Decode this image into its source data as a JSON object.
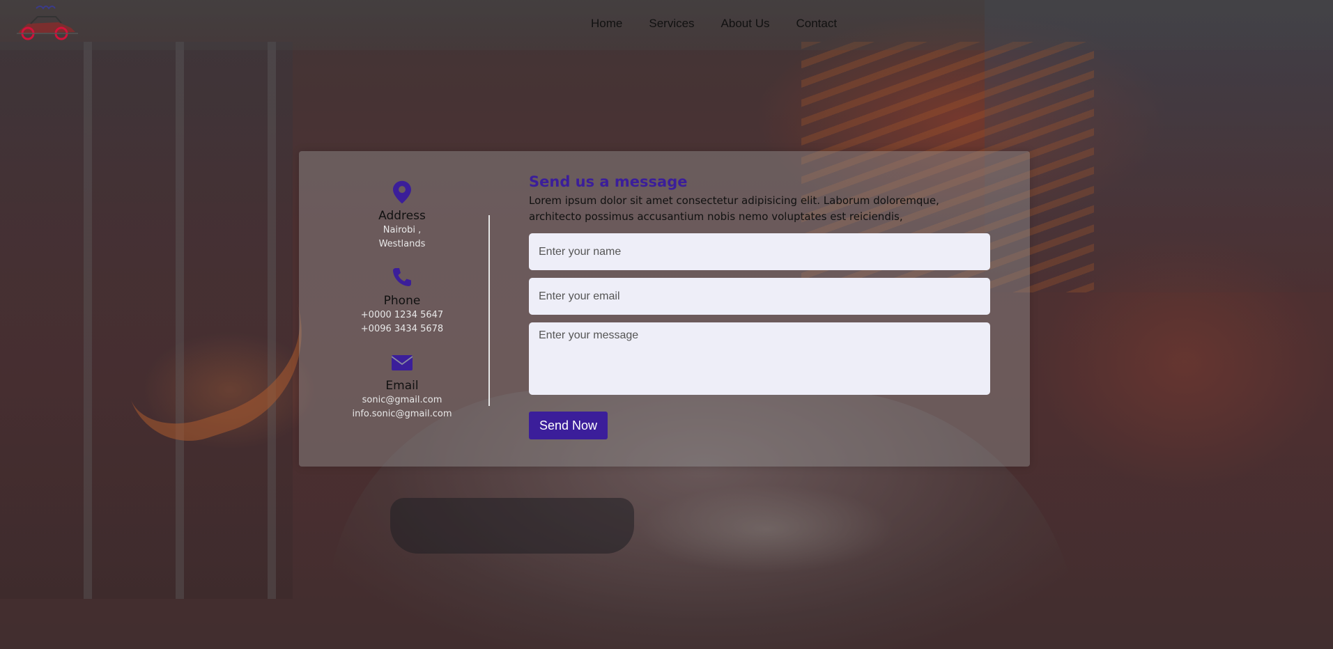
{
  "colors": {
    "accent": "#3b1e9a",
    "field_bg": "#eeeef8",
    "card_bg": "rgba(150,150,150,0.42)"
  },
  "header": {
    "logo_icon": "car-logo-icon",
    "nav": [
      {
        "label": "Home"
      },
      {
        "label": "Services"
      },
      {
        "label": "About Us"
      },
      {
        "label": "Contact"
      }
    ]
  },
  "contact_info": {
    "address": {
      "icon": "map-pin-icon",
      "title": "Address",
      "lines": [
        "Nairobi ,",
        "Westlands"
      ]
    },
    "phone": {
      "icon": "phone-icon",
      "title": "Phone",
      "lines": [
        "+0000 1234 5647",
        "+0096 3434 5678"
      ]
    },
    "email": {
      "icon": "envelope-icon",
      "title": "Email",
      "lines": [
        "sonic@gmail.com",
        "info.sonic@gmail.com"
      ]
    }
  },
  "form": {
    "title": "Send us a message",
    "description": "Lorem ipsum dolor sit amet consectetur adipisicing elit. Laborum doloremque, architecto possimus accusantium nobis nemo voluptates est reiciendis,",
    "name_placeholder": "Enter your name",
    "email_placeholder": "Enter your email",
    "message_placeholder": "Enter your message",
    "submit_label": "Send Now"
  }
}
